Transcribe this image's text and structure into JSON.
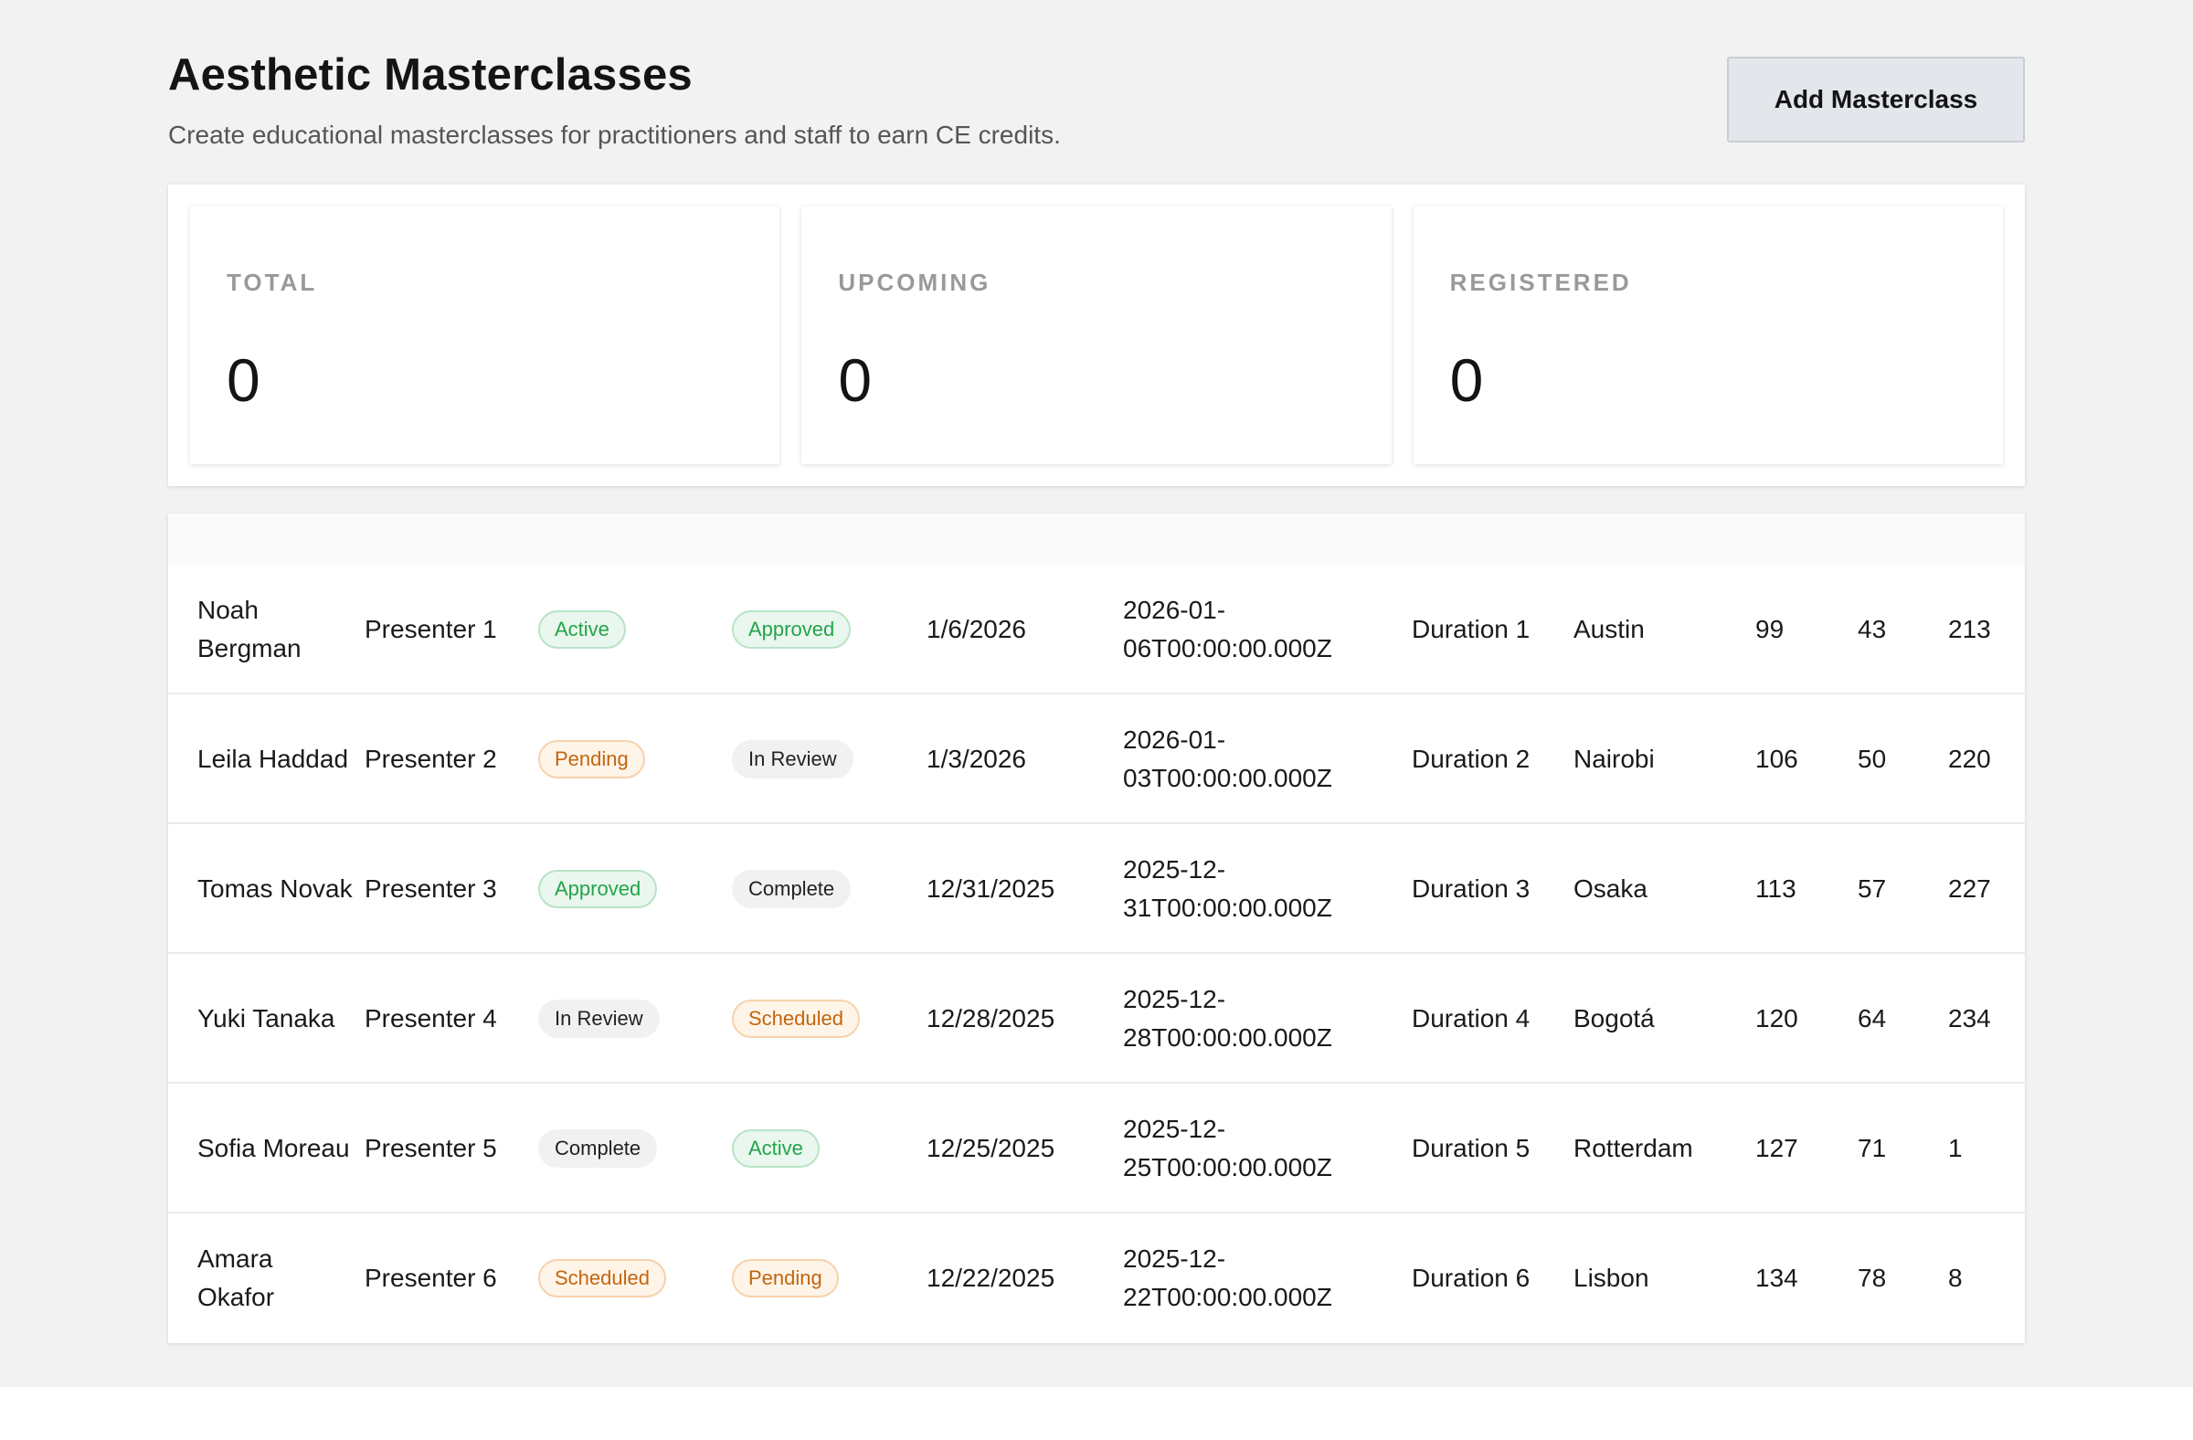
{
  "header": {
    "title": "Aesthetic Masterclasses",
    "subtitle": "Create educational masterclasses for practitioners and staff to earn CE credits.",
    "add_button_label": "Add Masterclass"
  },
  "stats": [
    {
      "label": "TOTAL",
      "value": "0"
    },
    {
      "label": "UPCOMING",
      "value": "0"
    },
    {
      "label": "REGISTERED",
      "value": "0"
    }
  ],
  "table": {
    "rows": [
      {
        "name": "Noah Bergman",
        "presenter": "Presenter 1",
        "status": "Active",
        "status_kind": "active",
        "approval": "Approved",
        "approval_kind": "approved",
        "date": "1/6/2026",
        "iso": "2026-01-06T00:00:00.000Z",
        "duration": "Duration 1",
        "city": "Austin",
        "n1": "99",
        "n2": "43",
        "n3": "213"
      },
      {
        "name": "Leila Haddad",
        "presenter": "Presenter 2",
        "status": "Pending",
        "status_kind": "pending",
        "approval": "In Review",
        "approval_kind": "review",
        "date": "1/3/2026",
        "iso": "2026-01-03T00:00:00.000Z",
        "duration": "Duration 2",
        "city": "Nairobi",
        "n1": "106",
        "n2": "50",
        "n3": "220"
      },
      {
        "name": "Tomas Novak",
        "presenter": "Presenter 3",
        "status": "Approved",
        "status_kind": "approved",
        "approval": "Complete",
        "approval_kind": "complete",
        "date": "12/31/2025",
        "iso": "2025-12-31T00:00:00.000Z",
        "duration": "Duration 3",
        "city": "Osaka",
        "n1": "113",
        "n2": "57",
        "n3": "227"
      },
      {
        "name": "Yuki Tanaka",
        "presenter": "Presenter 4",
        "status": "In Review",
        "status_kind": "review",
        "approval": "Scheduled",
        "approval_kind": "scheduled",
        "date": "12/28/2025",
        "iso": "2025-12-28T00:00:00.000Z",
        "duration": "Duration 4",
        "city": "Bogotá",
        "n1": "120",
        "n2": "64",
        "n3": "234"
      },
      {
        "name": "Sofia Moreau",
        "presenter": "Presenter 5",
        "status": "Complete",
        "status_kind": "complete",
        "approval": "Active",
        "approval_kind": "active",
        "date": "12/25/2025",
        "iso": "2025-12-25T00:00:00.000Z",
        "duration": "Duration 5",
        "city": "Rotterdam",
        "n1": "127",
        "n2": "71",
        "n3": "1"
      },
      {
        "name": "Amara Okafor",
        "presenter": "Presenter 6",
        "status": "Scheduled",
        "status_kind": "scheduled",
        "approval": "Pending",
        "approval_kind": "pending",
        "date": "12/22/2025",
        "iso": "2025-12-22T00:00:00.000Z",
        "duration": "Duration 6",
        "city": "Lisbon",
        "n1": "134",
        "n2": "78",
        "n3": "8"
      }
    ]
  }
}
